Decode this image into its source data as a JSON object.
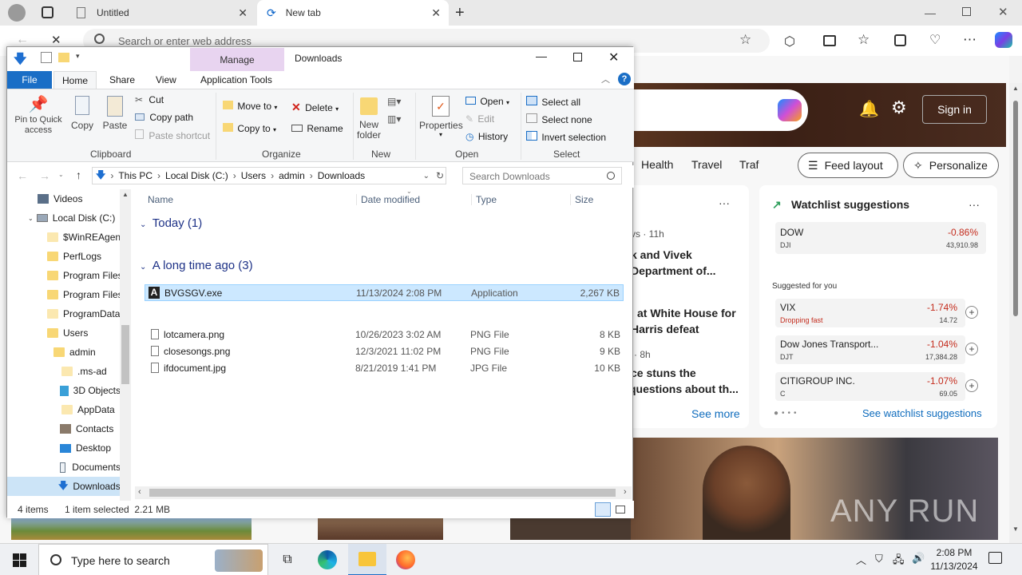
{
  "browser": {
    "tabs": [
      {
        "title": "Untitled"
      },
      {
        "title": "New tab"
      }
    ],
    "address_placeholder": "Search or enter web address",
    "sign_in": "Sign in"
  },
  "news": {
    "nav": [
      "Health",
      "Travel",
      "Traf"
    ],
    "feed_layout": "Feed layout",
    "personalize": "Personalize",
    "headline_time_1": "vs · 11h",
    "headline_1_line1": "k and Vivek",
    "headline_1_line2": "Department of...",
    "headline_2_line1": "at White House for",
    "headline_2_line2": "Harris defeat",
    "headline_time_3": "· 8h",
    "headline_3_line1": "ce stuns the",
    "headline_3_line2": "questions about th...",
    "see_more": "See more",
    "more_glyph": "···"
  },
  "watchlist": {
    "title": "Watchlist suggestions",
    "more": "···",
    "dow": {
      "name": "DOW",
      "ticker": "DJI",
      "change": "-0.86%",
      "value": "43,910.98"
    },
    "suggested_label": "Suggested for you",
    "items": [
      {
        "name": "VIX",
        "sub": "Dropping fast",
        "change": "-1.74%",
        "value": "14.72"
      },
      {
        "name": "Dow Jones Transport...",
        "sub": "DJT",
        "change": "-1.04%",
        "value": "17,384.28"
      },
      {
        "name": "CITIGROUP INC.",
        "sub": "C",
        "change": "-1.07%",
        "value": "69.05"
      }
    ],
    "see_suggestions": "See watchlist suggestions",
    "down_color": "#c42b1c"
  },
  "explorer": {
    "title": "Downloads",
    "context_tab": "Manage",
    "tabs": [
      "File",
      "Home",
      "Share",
      "View",
      "Application Tools"
    ],
    "ribbon": {
      "pin": "Pin to Quick access",
      "copy": "Copy",
      "paste": "Paste",
      "cut": "Cut",
      "copy_path": "Copy path",
      "paste_shortcut": "Paste shortcut",
      "clipboard": "Clipboard",
      "move_to": "Move to",
      "copy_to": "Copy to",
      "delete": "Delete",
      "rename": "Rename",
      "organize": "Organize",
      "new_folder_1": "New",
      "new_folder_2": "folder",
      "new": "New",
      "properties": "Properties",
      "open": "Open",
      "edit": "Edit",
      "history": "History",
      "open_group": "Open",
      "select_all": "Select all",
      "select_none": "Select none",
      "invert_selection": "Invert selection",
      "select": "Select"
    },
    "breadcrumb": [
      "This PC",
      "Local Disk (C:)",
      "Users",
      "admin",
      "Downloads"
    ],
    "search_placeholder": "Search Downloads",
    "tree": [
      "Videos",
      "Local Disk (C:)",
      "$WinREAgent",
      "PerfLogs",
      "Program Files",
      "Program Files",
      "ProgramData",
      "Users",
      "admin",
      ".ms-ad",
      "3D Objects",
      "AppData",
      "Contacts",
      "Desktop",
      "Documents",
      "Downloads"
    ],
    "columns": [
      "Name",
      "Date modified",
      "Type",
      "Size"
    ],
    "group_today": "Today (1)",
    "group_old": "A long time ago (3)",
    "files_today": [
      {
        "name": "BVGSGV.exe",
        "date": "11/13/2024 2:08 PM",
        "type": "Application",
        "size": "2,267 KB"
      }
    ],
    "files_old": [
      {
        "name": "lotcamera.png",
        "date": "10/26/2023 3:02 AM",
        "type": "PNG File",
        "size": "8 KB"
      },
      {
        "name": "closesongs.png",
        "date": "12/3/2021 11:02 PM",
        "type": "PNG File",
        "size": "9 KB"
      },
      {
        "name": "ifdocument.jpg",
        "date": "8/21/2019 1:41 PM",
        "type": "JPG File",
        "size": "10 KB"
      }
    ],
    "status_items": "4 items",
    "status_selected": "1 item selected  2.21 MB"
  },
  "taskbar": {
    "search_placeholder": "Type here to search",
    "time": "2:08 PM",
    "date": "11/13/2024"
  },
  "watermark": "ANY RUN"
}
